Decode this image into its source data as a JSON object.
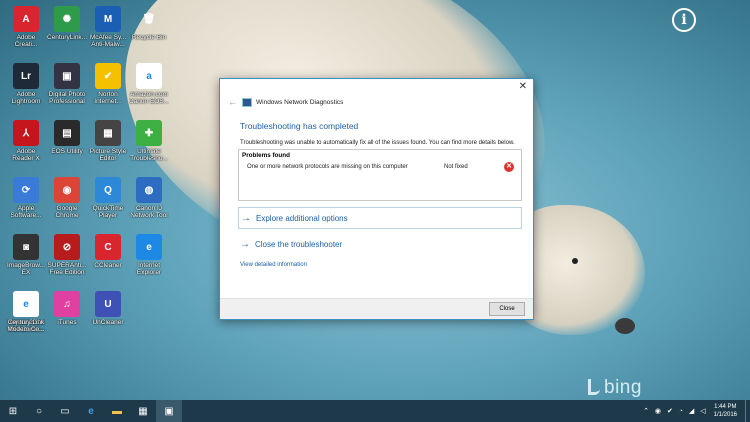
{
  "desktop": {
    "icons": [
      {
        "label1": "Adobe",
        "label2": "Creati...",
        "glyph": "A",
        "color": "#d9262e",
        "icon": "adobe-cc-icon"
      },
      {
        "label1": "CenturyLink...",
        "label2": "",
        "glyph": "✺",
        "color": "#2e9b4b",
        "icon": "centurylink-icon"
      },
      {
        "label1": "McAfee Sy...",
        "label2": "Anti-Malw...",
        "glyph": "M",
        "color": "#1a5fb4",
        "icon": "mcafee-icon"
      },
      {
        "label1": "Recycle Bin",
        "label2": "",
        "glyph": "🗑",
        "color": "transparent",
        "icon": "recycle-bin-icon"
      },
      {
        "label1": "Adobe",
        "label2": "Lightroom",
        "glyph": "Lr",
        "color": "#1e2a38",
        "icon": "lightroom-icon"
      },
      {
        "label1": "Digital Photo",
        "label2": "Professional",
        "glyph": "▣",
        "color": "#334",
        "icon": "digital-photo-icon"
      },
      {
        "label1": "Norton",
        "label2": "Internet...",
        "glyph": "✔",
        "color": "#f5c000",
        "icon": "norton-icon"
      },
      {
        "label1": "Amazon.com",
        "label2": "Canon EOS...",
        "glyph": "a",
        "color": "#fff",
        "icon": "amazon-icon"
      },
      {
        "label1": "Adobe",
        "label2": "Reader X",
        "glyph": "⅄",
        "color": "#c4161c",
        "icon": "adobe-reader-icon"
      },
      {
        "label1": "EOS Utility",
        "label2": "",
        "glyph": "▤",
        "color": "#2a2a2a",
        "icon": "eos-utility-icon"
      },
      {
        "label1": "Picture Style",
        "label2": "Editor",
        "glyph": "▦",
        "color": "#444",
        "icon": "picture-style-icon"
      },
      {
        "label1": "Ultimate",
        "label2": "Troublesho...",
        "glyph": "✚",
        "color": "#3cb043",
        "icon": "ultimate-troubleshooter-icon"
      },
      {
        "label1": "Apple",
        "label2": "Software...",
        "glyph": "⟳",
        "color": "#3b7bd8",
        "icon": "apple-software-icon"
      },
      {
        "label1": "Google",
        "label2": "Chrome",
        "glyph": "◉",
        "color": "#db4437",
        "icon": "chrome-icon"
      },
      {
        "label1": "QuickTime",
        "label2": "Player",
        "glyph": "Q",
        "color": "#2d89d8",
        "icon": "quicktime-icon"
      },
      {
        "label1": "Canon IJ",
        "label2": "Network Tool",
        "glyph": "◍",
        "color": "#2d6cc0",
        "icon": "canon-ij-icon"
      },
      {
        "label1": "ImageBrow...",
        "label2": "EX",
        "glyph": "◙",
        "color": "#333",
        "icon": "imagebrowser-icon"
      },
      {
        "label1": "SUPERAnti...",
        "label2": "Free Edition",
        "glyph": "⊘",
        "color": "#b71c1c",
        "icon": "superantispyware-icon"
      },
      {
        "label1": "CCleaner",
        "label2": "",
        "glyph": "C",
        "color": "#d9262e",
        "icon": "ccleaner-icon"
      },
      {
        "label1": "Internet",
        "label2": "Explorer",
        "glyph": "e",
        "color": "#1e88e5",
        "icon": "internet-explorer-icon"
      },
      {
        "label1": "Toyota 2014",
        "label2": "4X4 Owne...",
        "glyph": "e",
        "color": "#fff",
        "icon": "toyota-doc-icon"
      },
      {
        "label1": "Century Link",
        "label2": "Modem Co...",
        "glyph": "e",
        "color": "#fff",
        "icon": "centurylink-modem-icon"
      },
      {
        "label1": "iTunes",
        "label2": "",
        "glyph": "♫",
        "color": "#e040a0",
        "icon": "itunes-icon"
      },
      {
        "label1": "UnCleaner",
        "label2": "",
        "glyph": "U",
        "color": "#3f51b5",
        "icon": "uncleaner-icon"
      }
    ],
    "bing_label": "bing"
  },
  "dialog": {
    "title": "Windows Network Diagnostics",
    "heading": "Troubleshooting has completed",
    "description": "Troubleshooting was unable to automatically fix all of the issues found. You can find more details below.",
    "problems_header": "Problems found",
    "problem_text": "One or more network protocols are missing on this computer",
    "problem_status": "Not fixed",
    "explore_link": "Explore additional options",
    "close_troubleshooter_link": "Close the troubleshooter",
    "detailed_info_link": "View detailed information",
    "close_button": "Close"
  },
  "taskbar": {
    "time": "1:44 PM",
    "date": "1/1/2016"
  }
}
